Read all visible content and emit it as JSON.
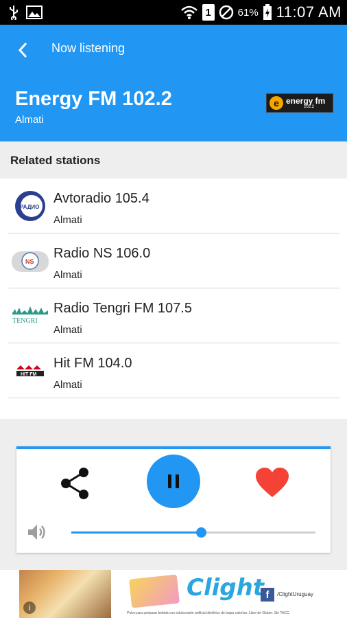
{
  "status_bar": {
    "battery": "61%",
    "sim": "1",
    "time": "11:07 AM",
    "icons": [
      "usb-icon",
      "image-icon",
      "wifi-icon",
      "sim-icon",
      "do-not-disturb-icon",
      "battery-icon"
    ]
  },
  "header": {
    "toolbar_title": "Now listening",
    "station_name": "Energy FM 102.2",
    "station_city": "Almati",
    "logo_text": "energy fm",
    "logo_sub": "102.2",
    "accent": "#2196F3"
  },
  "related": {
    "heading": "Related stations",
    "stations": [
      {
        "name": "Avtoradio 105.4",
        "city": "Almati"
      },
      {
        "name": "Radio NS 106.0",
        "city": "Almati"
      },
      {
        "name": "Radio Tengri FM 107.5",
        "city": "Almati"
      },
      {
        "name": "Hit FM 104.0",
        "city": "Almati"
      }
    ]
  },
  "player": {
    "state": "playing",
    "volume_level": 0.53,
    "favorite_color": "#F44336"
  },
  "ad": {
    "brand": "Clight",
    "handle": "/ClightUruguay",
    "fine_print": "Polvo para preparar bebida con edulcorante artificial dietético de bajas calorías. Libre de Gluten. Sin TACC."
  }
}
